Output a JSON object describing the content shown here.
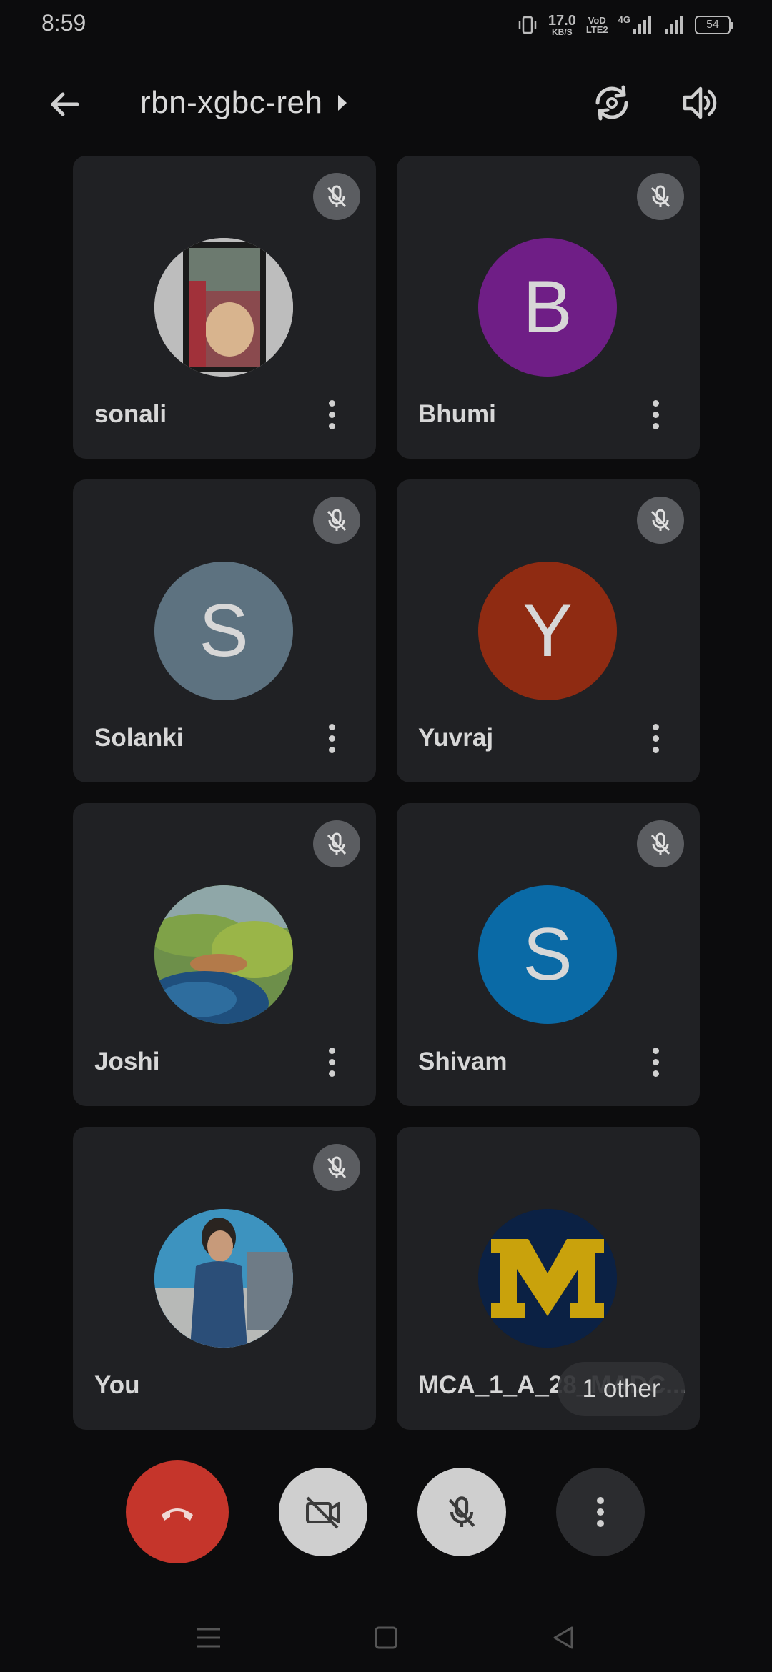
{
  "status_bar": {
    "time": "8:59",
    "net_speed_value": "17.0",
    "net_speed_unit": "KB/S",
    "volte_line1": "VoD",
    "volte_line2": "LTE2",
    "network_label": "4G",
    "battery": "54"
  },
  "header": {
    "meeting_code": "rbn-xgbc-reh"
  },
  "colors": {
    "background": "#0c0c0d",
    "tile_background": "#202124",
    "end_call": "#c5352b",
    "avatar_bhumi": "#6f1e86",
    "avatar_solanki": "#5d7280",
    "avatar_yuvraj": "#8f2b12",
    "avatar_shivam": "#0a6aa6",
    "avatar_mca": "#0b2144",
    "mca_logo_yellow": "#c9a20c"
  },
  "participants": [
    {
      "name": "sonali",
      "initial": "",
      "avatar_type": "photo",
      "muted": true,
      "has_menu": true
    },
    {
      "name": "Bhumi",
      "initial": "B",
      "avatar_type": "initial",
      "muted": true,
      "has_menu": true
    },
    {
      "name": "Solanki",
      "initial": "S",
      "avatar_type": "initial",
      "muted": true,
      "has_menu": true
    },
    {
      "name": "Yuvraj",
      "initial": "Y",
      "avatar_type": "initial",
      "muted": true,
      "has_menu": true
    },
    {
      "name": "Joshi",
      "initial": "",
      "avatar_type": "photo",
      "muted": true,
      "has_menu": true
    },
    {
      "name": "Shivam",
      "initial": "S",
      "avatar_type": "initial",
      "muted": true,
      "has_menu": true
    },
    {
      "name": "You",
      "initial": "",
      "avatar_type": "photo",
      "muted": true,
      "has_menu": false
    },
    {
      "name": "MCA_1_A_28_MADC...",
      "initial": "M",
      "avatar_type": "logo",
      "muted": false,
      "has_menu": false
    }
  ],
  "others_pill": "1 other",
  "icons": {
    "back": "arrow-left-icon",
    "switch_camera": "switch-camera-icon",
    "speaker": "speaker-icon",
    "mute": "mic-off-icon",
    "menu": "more-vert-icon",
    "end_call": "phone-hangup-icon",
    "camera_off": "video-off-icon",
    "mic_off": "mic-off-icon",
    "more": "more-vert-icon",
    "nav_menu": "menu-icon",
    "nav_home": "square-icon",
    "nav_back": "triangle-back-icon"
  }
}
